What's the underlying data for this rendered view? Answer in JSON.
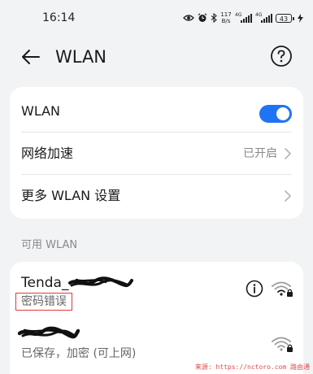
{
  "status_bar": {
    "time": "16:14",
    "speed_value": "117",
    "speed_unit": "B/s",
    "signal_1_label": "4G",
    "signal_2_label": "4G",
    "battery": "43"
  },
  "header": {
    "title": "WLAN"
  },
  "settings_card": {
    "wlan_label": "WLAN",
    "wlan_enabled": true,
    "network_boost_label": "网络加速",
    "network_boost_value": "已开启",
    "more_settings_label": "更多 WLAN 设置"
  },
  "available_section": {
    "title": "可用 WLAN",
    "networks": [
      {
        "name": "Tenda_",
        "status": "密码错误",
        "secured": true
      },
      {
        "name": "",
        "status": "已保存，加密 (可上网)",
        "secured": true
      }
    ]
  },
  "watermark": "来源: https://nctoro.com 路由通",
  "colors": {
    "accent": "#1f74f5",
    "background": "#f1f3f5",
    "card": "#ffffff",
    "error_highlight": "#e23a3a",
    "secondary_text": "#8a8a8a"
  },
  "icons": [
    "back-arrow-icon",
    "help-icon",
    "chevron-right-icon",
    "info-icon",
    "wifi-lock-icon",
    "eye-icon",
    "alarm-icon",
    "bluetooth-icon",
    "signal-icon",
    "battery-icon",
    "charging-icon"
  ]
}
